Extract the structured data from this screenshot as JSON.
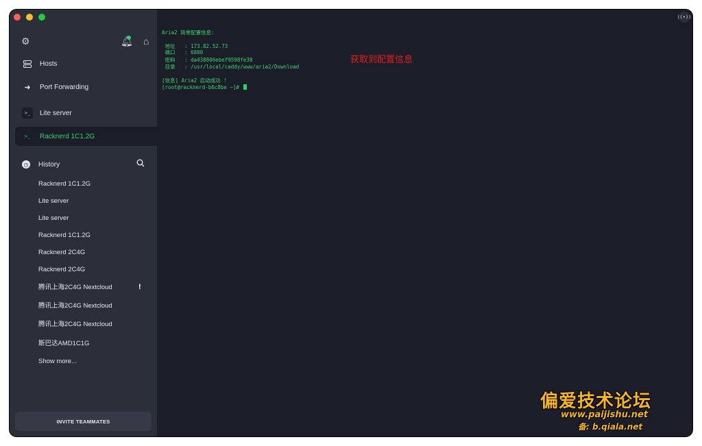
{
  "sidebar": {
    "icons": {
      "settings": "gear-icon",
      "notifications": "bell-icon",
      "home": "home-icon"
    },
    "nav": [
      {
        "label": "Hosts",
        "icon": "server-icon"
      },
      {
        "label": "Port Forwarding",
        "icon": "forward-arrow-icon"
      },
      {
        "label": "Lite server",
        "icon": "terminal-icon"
      },
      {
        "label": "Racknerd 1C1.2G",
        "icon": "terminal-icon",
        "active": true
      }
    ],
    "history_label": "History",
    "history_items": [
      "Racknerd 1C1.2G",
      "Lite server",
      "Lite server",
      "Racknerd 1C1.2G",
      "Racknerd 2C4G",
      "Racknerd 2C4G",
      "腾讯上海2C4G Nextcloud",
      "腾讯上海2C4G Nextcloud",
      "腾讯上海2C4G Nextcloud",
      "斯巴达AMD1C1G",
      "Show more..."
    ],
    "warning_mark": "!",
    "invite_label": "INVITE TEAMMATES"
  },
  "terminal": {
    "lines": [
      "Aria2 简单配置信息:",
      "",
      " 地址   : 173.82.52.73",
      " 端口   : 6800",
      " 密码   : da438806ebef9598fe38",
      " 目录   : /usr/local/caddy/www/aria2/Download",
      "",
      "[信息] Aria2 启动成功 !",
      "[root@racknerd-b6c8be ~]# "
    ],
    "text_color": "#3fd36e"
  },
  "annotation": "获取到配置信息",
  "watermark": {
    "title": "偏爱技术论坛",
    "url": "www.paijishu.net",
    "backup": "备: b.qiala.net"
  }
}
